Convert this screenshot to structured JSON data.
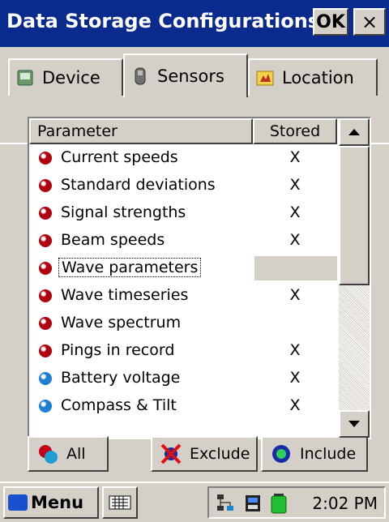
{
  "window": {
    "title": "Data Storage Configurations",
    "ok_label": "OK",
    "close_label": "×"
  },
  "tabs": [
    {
      "label": "Device",
      "icon": "device-icon"
    },
    {
      "label": "Sensors",
      "icon": "sensors-icon",
      "selected": true
    },
    {
      "label": "Location",
      "icon": "location-icon"
    }
  ],
  "list": {
    "columns": {
      "parameter": "Parameter",
      "stored": "Stored"
    },
    "rows": [
      {
        "label": "Current speeds",
        "stored": "X",
        "dot_color": "#b00010"
      },
      {
        "label": "Standard deviations",
        "stored": "X",
        "dot_color": "#b00010"
      },
      {
        "label": "Signal strengths",
        "stored": "X",
        "dot_color": "#b00010"
      },
      {
        "label": "Beam speeds",
        "stored": "X",
        "dot_color": "#b00010"
      },
      {
        "label": "Wave parameters",
        "stored": "",
        "dot_color": "#b00010",
        "selected": true
      },
      {
        "label": "Wave timeseries",
        "stored": "X",
        "dot_color": "#b00010"
      },
      {
        "label": "Wave spectrum",
        "stored": "",
        "dot_color": "#b00010"
      },
      {
        "label": "Pings in record",
        "stored": "X",
        "dot_color": "#b00010"
      },
      {
        "label": "Battery voltage",
        "stored": "X",
        "dot_color": "#1e7fd0"
      },
      {
        "label": "Compass & Tilt",
        "stored": "X",
        "dot_color": "#1e7fd0"
      }
    ]
  },
  "buttons": {
    "all": "All",
    "exclude": "Exclude",
    "include": "Include"
  },
  "taskbar": {
    "start": "Menu",
    "clock": "2:02 PM"
  }
}
